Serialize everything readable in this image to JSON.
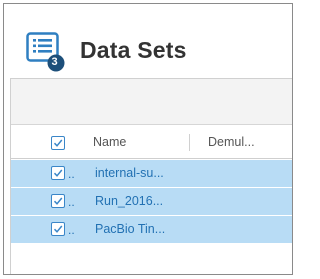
{
  "header": {
    "title": "Data Sets",
    "badge_count": "3",
    "icon": "list-icon"
  },
  "grid": {
    "columns": [
      "Name",
      "Demul..."
    ],
    "rows": [
      {
        "name": "internal-su...",
        "selected": true
      },
      {
        "name": "Run_2016...",
        "selected": true
      },
      {
        "name": "PacBio Tin...",
        "selected": true
      }
    ],
    "row_overflow_marker": ".."
  },
  "colors": {
    "accent": "#2f7fc1",
    "badge": "#1d4f7a",
    "row_selected": "#b8dcf5",
    "link_text": "#2271b3"
  }
}
